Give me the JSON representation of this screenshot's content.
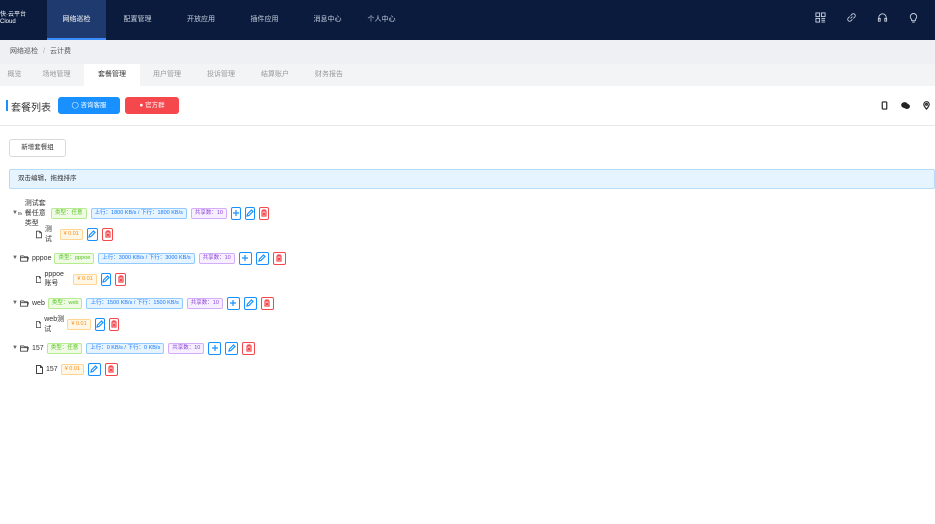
{
  "brand": {
    "line1": "快·云平台",
    "line2": "Cloud"
  },
  "topnav": [
    {
      "label": "网络巡检",
      "active": true
    },
    {
      "label": "配置管理",
      "active": false
    },
    {
      "label": "开放应用",
      "active": false
    },
    {
      "label": "插件应用",
      "active": false
    },
    {
      "label": "消息中心",
      "active": false
    },
    {
      "label": "个人中心",
      "active": false
    }
  ],
  "top_icons": [
    "grid-icon",
    "link-icon",
    "headset-icon",
    "bulb-icon"
  ],
  "breadcrumb": {
    "first": "网络巡检",
    "sep": "/",
    "second": "云计费"
  },
  "tabs": [
    {
      "label": "概览",
      "active": false
    },
    {
      "label": "场地管理",
      "active": false
    },
    {
      "label": "套餐管理",
      "active": true
    },
    {
      "label": "用户管理",
      "active": false
    },
    {
      "label": "投诉管理",
      "active": false
    },
    {
      "label": "结算账户",
      "active": false
    },
    {
      "label": "财务报告",
      "active": false
    }
  ],
  "header": {
    "title": "套餐列表",
    "consult_button": "咨询客服",
    "official_button": "官方群",
    "right_icons": [
      "phone-icon",
      "wechat-icon",
      "location-icon"
    ]
  },
  "actions": {
    "add_group": "新增套餐组"
  },
  "notice": "双击编辑，拖拽排序",
  "groups": [
    {
      "name": "测试套餐任意类型",
      "type_tag": "类型：任意",
      "speed_tag": "上行：1800 KB/s / 下行：1800 KB/s",
      "share_tag": "共享数：10",
      "items": [
        {
          "name": "测试",
          "price": "¥ 0.01"
        }
      ]
    },
    {
      "name": "pppoe",
      "type_tag": "类型：pppoe",
      "speed_tag": "上行：3000 KB/s / 下行：3000 KB/s",
      "share_tag": "共享数：10",
      "items": [
        {
          "name": "pppoe账号",
          "price": "¥ 0.01"
        }
      ]
    },
    {
      "name": "web",
      "type_tag": "类型：web",
      "speed_tag": "上行：1500 KB/s / 下行：1500 KB/s",
      "share_tag": "共享数：10",
      "items": [
        {
          "name": "web测试",
          "price": "¥ 0.01"
        }
      ]
    },
    {
      "name": "157",
      "type_tag": "类型：任意",
      "speed_tag": "上行：0 KB/s / 下行：0 KB/s",
      "share_tag": "共享数：10",
      "items": [
        {
          "name": "157",
          "price": "¥ 0.01"
        }
      ]
    }
  ],
  "colors": {
    "topbar": "#0a1b3d",
    "primary": "#1890ff",
    "danger": "#f5484d"
  }
}
